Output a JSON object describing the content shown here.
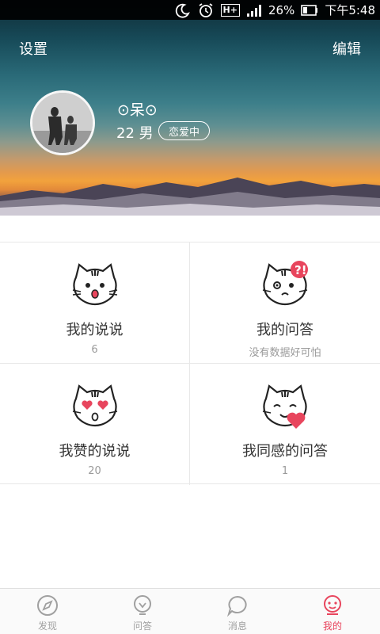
{
  "status_bar": {
    "battery": "26%",
    "time": "下午5:48",
    "network": "H+"
  },
  "header": {
    "settings_label": "设置",
    "edit_label": "编辑"
  },
  "profile": {
    "nickname": "⊙呆⊙",
    "age_sex": "22 男",
    "relationship_status": "恋爱中"
  },
  "grid": [
    {
      "title": "我的说说",
      "sub": "6"
    },
    {
      "title": "我的问答",
      "sub": "没有数据好可怕"
    },
    {
      "title": "我赞的说说",
      "sub": "20"
    },
    {
      "title": "我同感的问答",
      "sub": "1"
    }
  ],
  "bottom_nav": [
    {
      "label": "发现",
      "icon": "compass-icon"
    },
    {
      "label": "问答",
      "icon": "lightbulb-icon"
    },
    {
      "label": "消息",
      "icon": "chat-bubble-icon"
    },
    {
      "label": "我的",
      "icon": "profile-face-icon",
      "active": true
    }
  ],
  "colors": {
    "accent": "#e8455d",
    "inactive": "#a0a0a0"
  }
}
